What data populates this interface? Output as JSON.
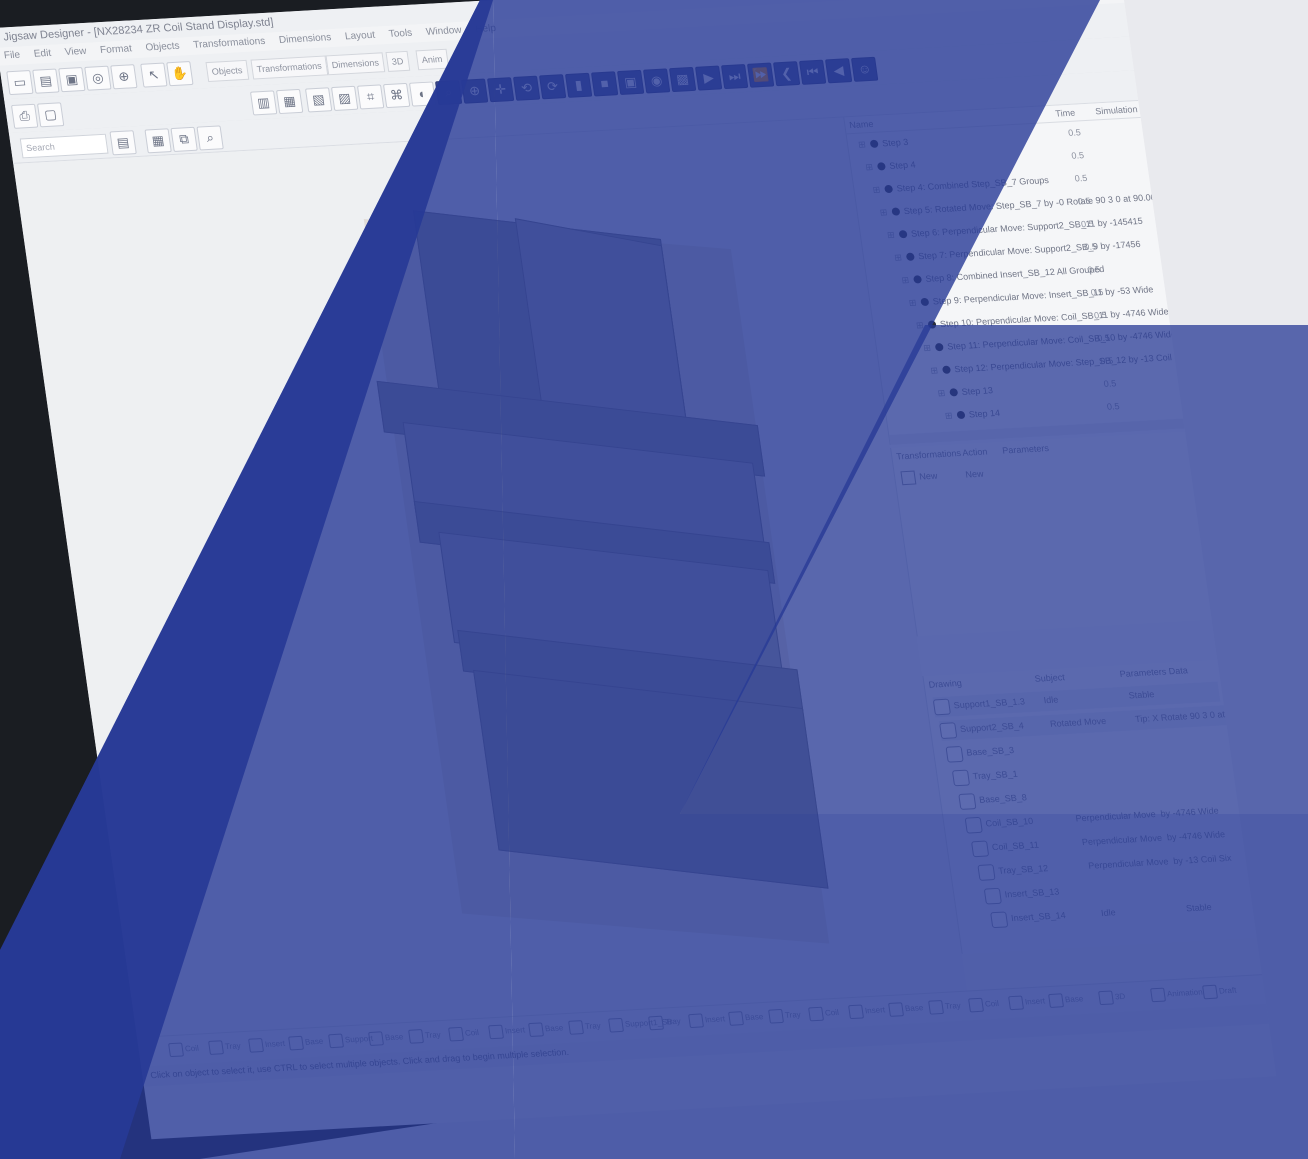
{
  "window": {
    "title": "Jigsaw Designer - [NX28234 ZR Coil Stand Display.std]",
    "min_label": "–",
    "close_label": "×"
  },
  "menu": [
    "File",
    "Edit",
    "View",
    "Format",
    "Objects",
    "Transformations",
    "Dimensions",
    "Layout",
    "Tools",
    "Window",
    "Help"
  ],
  "tabs": {
    "objects": "Objects",
    "transformations": "Transformations",
    "dimensions": "Dimensions",
    "view3d": "3D",
    "anim": "Anim"
  },
  "search": {
    "placeholder": "Search"
  },
  "tree": {
    "headers": [
      "Name",
      "Time",
      "Simulation"
    ],
    "steps": [
      {
        "label": "Step 3",
        "time": "0.5"
      },
      {
        "label": "Step 4",
        "time": "0.5"
      },
      {
        "label": "Step 4: Combined Step_SB_7 Groups",
        "time": "0.5"
      },
      {
        "label": "Step 5: Rotated Move: Step_SB_7 by -0 Rotate 90 3 0 at 90.00",
        "time": "0.5"
      },
      {
        "label": "Step 6: Perpendicular Move: Support2_SB_11 by -145415",
        "time": "0.5"
      },
      {
        "label": "Step 7: Perpendicular Move: Support2_SB_9 by -17456",
        "time": "0.5"
      },
      {
        "label": "Step 8: Combined Insert_SB_12 All Grouped",
        "time": "0.5"
      },
      {
        "label": "Step 9: Perpendicular Move: Insert_SB_11 by -53 Wide",
        "time": "0.5"
      },
      {
        "label": "Step 10: Perpendicular Move: Coil_SB_11 by -4746 Wide",
        "time": "0.5"
      },
      {
        "label": "Step 11: Perpendicular Move: Coil_SB_10 by -4746 Wide",
        "time": "0.5"
      },
      {
        "label": "Step 12: Perpendicular Move: Step_SB_12 by -13 Coil Six",
        "time": "0.5"
      },
      {
        "label": "Step 13",
        "time": "0.5"
      },
      {
        "label": "Step 14",
        "time": "0.5"
      }
    ]
  },
  "props": {
    "headers": [
      "Transformations",
      "Action",
      "Parameters"
    ],
    "new_label": "New",
    "new_action": "New"
  },
  "drawing": {
    "headers": [
      "Drawing",
      "Subject",
      "Parameters Data"
    ],
    "rows": [
      {
        "name": "Support1_SB_1.3",
        "a1": "Idle",
        "a2": "Stable"
      },
      {
        "name": "Support2_SB_4",
        "a1": "Rotated Move",
        "a2": "Tip: X Rotate 90 3 0 at 90.00"
      },
      {
        "name": "Base_SB_3",
        "a1": "",
        "a2": ""
      },
      {
        "name": "Tray_SB_1",
        "a1": "",
        "a2": ""
      },
      {
        "name": "Base_SB_8",
        "a1": "",
        "a2": ""
      },
      {
        "name": "Coil_SB_10",
        "a1": "Perpendicular Move",
        "a2": "by -4746 Wide"
      },
      {
        "name": "Coil_SB_11",
        "a1": "Perpendicular Move",
        "a2": "by -4746 Wide"
      },
      {
        "name": "Tray_SB_12",
        "a1": "Perpendicular Move",
        "a2": "by -13 Coil Six"
      },
      {
        "name": "Insert_SB_13",
        "a1": "",
        "a2": ""
      },
      {
        "name": "Insert_SB_14",
        "a1": "Idle",
        "a2": "Stable"
      }
    ]
  },
  "bottom_tabs": [
    "Coil",
    "Tray",
    "Insert",
    "Base",
    "Support",
    "Base",
    "Tray",
    "Coil",
    "Insert",
    "Base",
    "Tray",
    "Support1_SB",
    "Tray",
    "Insert",
    "Base",
    "Tray",
    "Coil",
    "Insert",
    "Base",
    "Tray",
    "Coil",
    "Insert",
    "Base"
  ],
  "bottom_right": [
    "3D",
    "Animation",
    "Draft"
  ],
  "status": {
    "text": "Click on object to select it, use CTRL to select multiple objects. Click and drag to begin multiple selection."
  },
  "colors": {
    "overlay": "#273a96",
    "model": "#8d8f97"
  }
}
